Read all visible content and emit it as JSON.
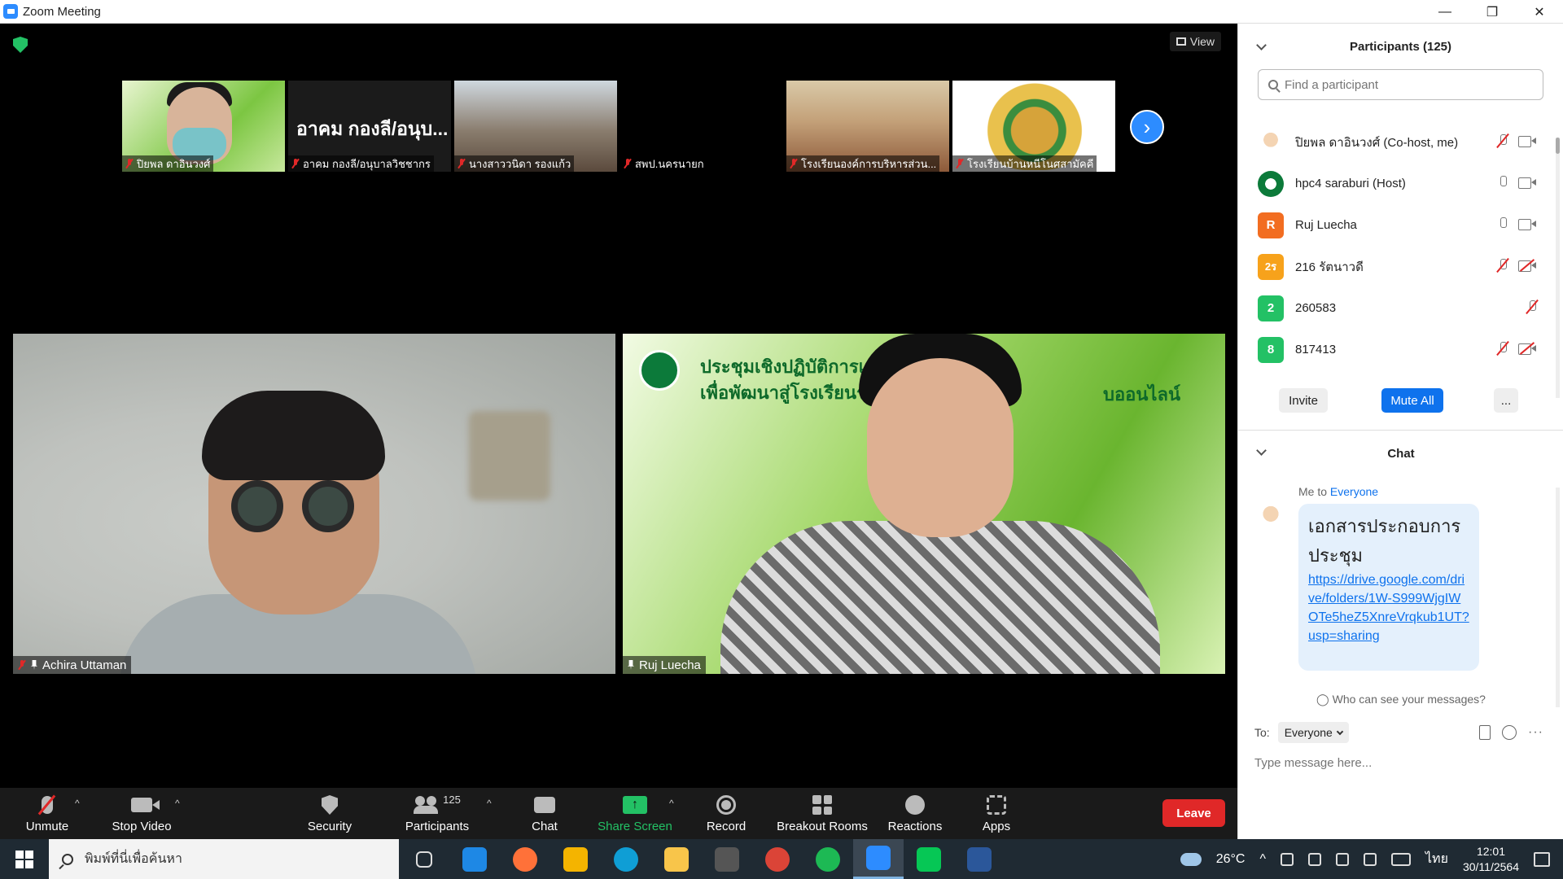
{
  "window": {
    "title": "Zoom Meeting",
    "min": "—",
    "max": "❐",
    "close": "✕"
  },
  "stage": {
    "view_label": "View",
    "thumbnails": [
      {
        "name": "ปิยพล ดาอินวงศ์"
      },
      {
        "name": "อาคม กองลี/อนุบาลวิชชากร",
        "big_text": "อาคม กองลี/อนุบ..."
      },
      {
        "name": "นางสาววนิดา รองแก้ว"
      },
      {
        "name": "สพป.นครนายก"
      },
      {
        "name": "โรงเรียนองค์การบริหารส่วน..."
      },
      {
        "name": "โรงเรียนบ้านหนีโนศสามัคคี"
      }
    ],
    "next_arrow": "›",
    "tiles": [
      {
        "name": "Achira Uttaman"
      },
      {
        "name": "Ruj Luecha",
        "banner_line1": "ประชุมเชิงปฏิบัติการเตรีย",
        "banner_line2": "เพื่อพัฒนาสู่โรงเรียนรอบ",
        "banner_line3": "บออนไลน์"
      }
    ]
  },
  "toolbar": {
    "unmute": "Unmute",
    "stop_video": "Stop Video",
    "security": "Security",
    "participants": "Participants",
    "participants_count": "125",
    "chat": "Chat",
    "share_screen": "Share Screen",
    "share_icon": "↑",
    "record": "Record",
    "breakout_rooms": "Breakout Rooms",
    "reactions": "Reactions",
    "apps": "Apps",
    "leave": "Leave",
    "caret": "^"
  },
  "participants_panel": {
    "title": "Participants (125)",
    "search_placeholder": "Find a participant",
    "people": [
      {
        "name": "ปิยพล ดาอินวงศ์ (Co-host, me)",
        "avatar": "",
        "mic": "off",
        "cam": "on"
      },
      {
        "name": "hpc4 saraburi (Host)",
        "avatar": "",
        "mic": "on",
        "cam": "on"
      },
      {
        "name": "Ruj Luecha",
        "avatar": "R",
        "avatar_color": "#f26d21",
        "mic": "on",
        "cam": "on"
      },
      {
        "name": "216 รัตนาวดี",
        "avatar": "2ร",
        "avatar_color": "#f7a21b",
        "mic": "off",
        "cam": "off"
      },
      {
        "name": "260583",
        "avatar": "2",
        "avatar_color": "#23c165",
        "mic": "off",
        "cam": "none"
      },
      {
        "name": "817413",
        "avatar": "8",
        "avatar_color": "#23c165",
        "mic": "off",
        "cam": "off"
      }
    ],
    "invite": "Invite",
    "mute_all": "Mute All",
    "more": "..."
  },
  "chat_panel": {
    "title": "Chat",
    "sender": "Me to",
    "recipient": "Everyone",
    "message_text": "เอกสารประกอบการประชุม",
    "message_link": "https://drive.google.com/drive/folders/1W-S999WjgIWOTe5heZ5XnreVrqkub1UT?usp=sharing",
    "who_can_see": "Who can see your messages?",
    "to_label": "To:",
    "to_value": "Everyone",
    "more_icon": "···",
    "input_placeholder": "Type message here..."
  },
  "taskbar": {
    "search_placeholder": "พิมพ์ที่นี่เพื่อค้นหา",
    "weather": "26°C",
    "lang": "ไทย",
    "time": "12:01",
    "date": "30/11/2564",
    "tray_chevron": "^",
    "apps": [
      {
        "name": "task-view",
        "color": "#1f2a33"
      },
      {
        "name": "mail",
        "color": "#1e88e5"
      },
      {
        "name": "firefox",
        "color": "#ff7139"
      },
      {
        "name": "store",
        "color": "#f4b400"
      },
      {
        "name": "edge",
        "color": "#0f9ed5"
      },
      {
        "name": "file-explorer",
        "color": "#f8c54a"
      },
      {
        "name": "photos",
        "color": "#555555"
      },
      {
        "name": "chrome",
        "color": "#db4437"
      },
      {
        "name": "spotify",
        "color": "#1db954"
      },
      {
        "name": "zoom",
        "color": "#2d8cff"
      },
      {
        "name": "line",
        "color": "#06c755"
      },
      {
        "name": "word",
        "color": "#2b579a"
      }
    ]
  }
}
